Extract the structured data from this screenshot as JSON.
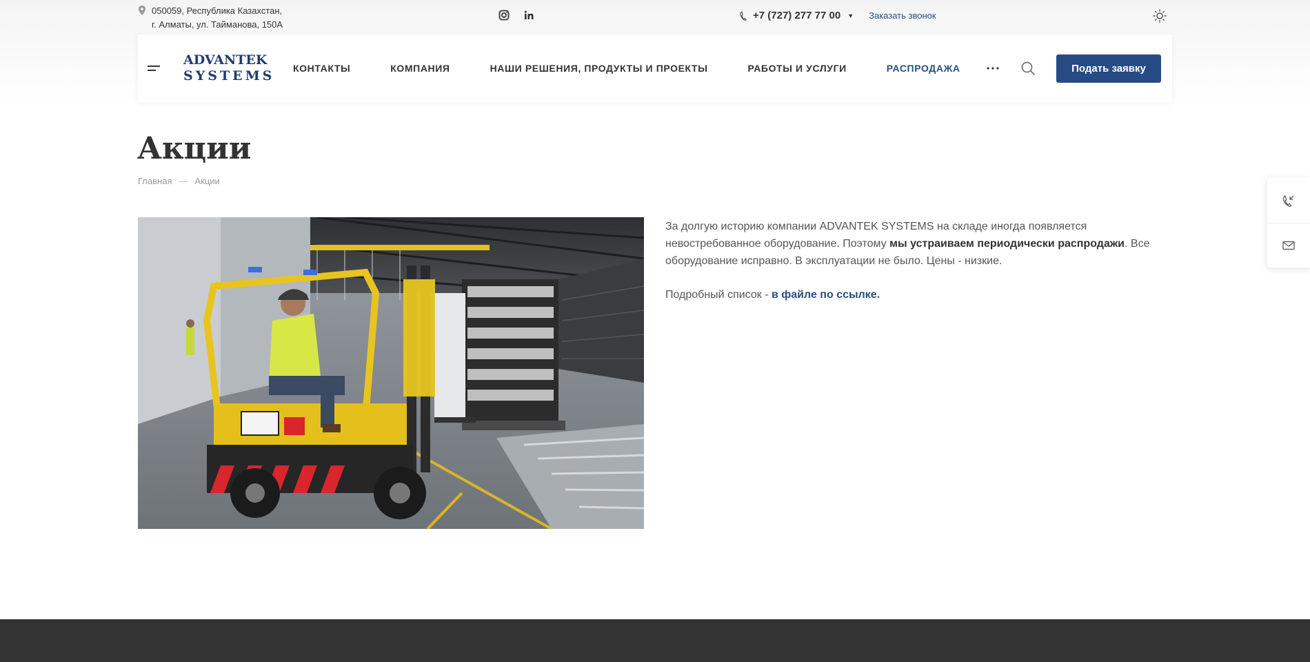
{
  "topbar": {
    "address_line1": "050059, Республика Казахстан,",
    "address_line2": "г. Алматы, ул. Тайманова, 150А",
    "phone": "+7 (727) 277 77 00",
    "callback": "Заказать звонок"
  },
  "header": {
    "logo_line1": "ADVANTEK",
    "logo_line2": "SYSTEMS",
    "nav": [
      {
        "label": "КОНТАКТЫ"
      },
      {
        "label": "КОМПАНИЯ"
      },
      {
        "label": "НАШИ РЕШЕНИЯ, ПРОДУКТЫ И ПРОЕКТЫ"
      },
      {
        "label": "РАБОТЫ И УСЛУГИ"
      },
      {
        "label": "РАСПРОДАЖА"
      }
    ],
    "cta_label": "Подать заявку"
  },
  "page": {
    "title": "Акции",
    "breadcrumb": [
      "Главная",
      "Акции"
    ],
    "breadcrumb_sep": "—"
  },
  "content": {
    "p1_a": "За долгую историю компании ADVANTEK SYSTEMS на складе иногда появляется невостребованное оборудование. Поэтому ",
    "p1_bold": "мы устраиваем периодически распродажи",
    "p1_b": ". Все оборудование исправно. В эксплуатации не было. Цены - низкие.",
    "p2_a": "Подробный список - ",
    "p2_link": "в файле по ссылке."
  },
  "colors": {
    "accent": "#274c85",
    "footer": "#333333"
  },
  "icons": [
    "location-pin-icon",
    "instagram-icon",
    "linkedin-icon",
    "phone-icon",
    "sun-icon",
    "menu-icon",
    "more-dots-icon",
    "search-icon",
    "callback-phone-icon",
    "mail-icon"
  ]
}
